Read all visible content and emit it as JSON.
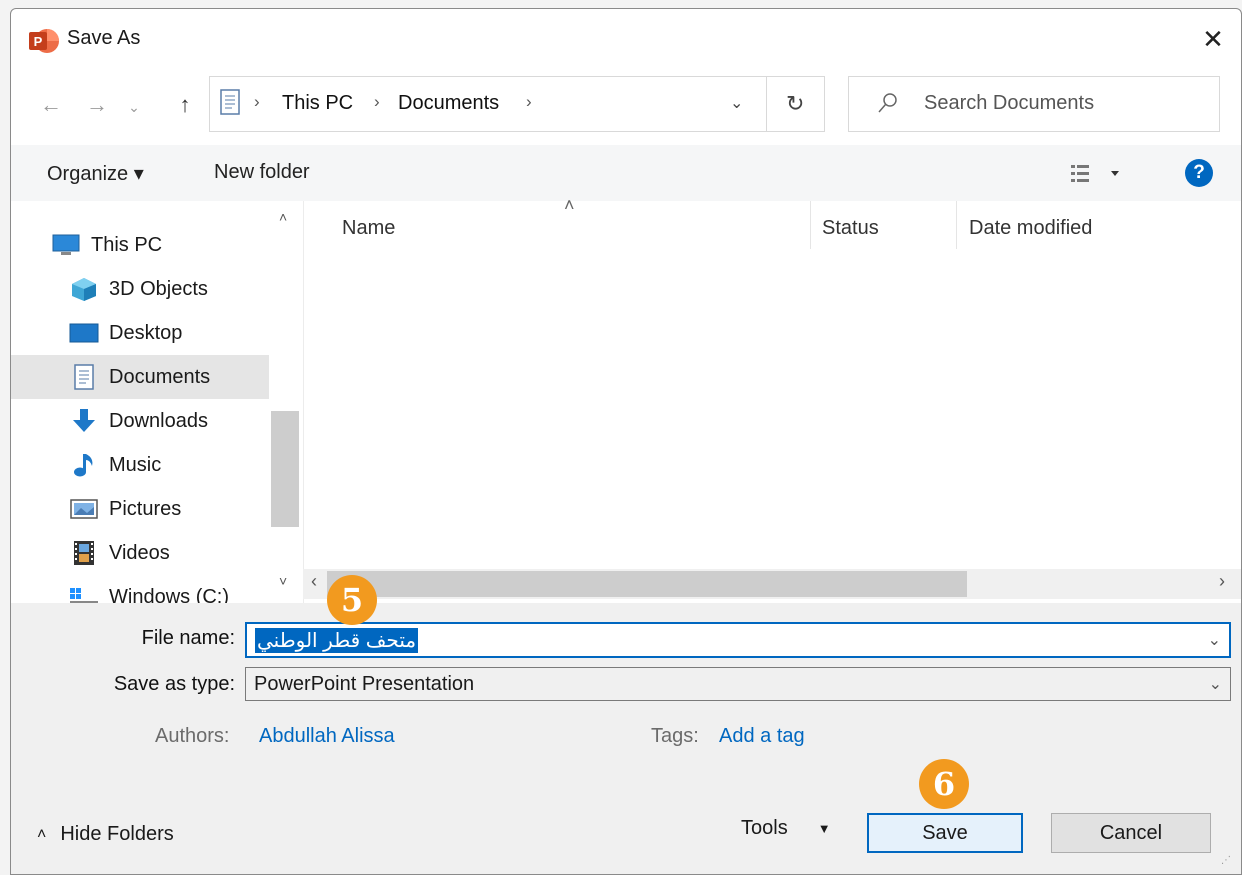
{
  "window": {
    "title": "Save As"
  },
  "address": {
    "segments": [
      "This PC",
      "Documents"
    ]
  },
  "search": {
    "placeholder": "Search Documents"
  },
  "toolbar": {
    "organize": "Organize ▾",
    "new_folder": "New folder"
  },
  "sidebar": {
    "items": [
      {
        "label": "This PC",
        "icon": "computer-icon"
      },
      {
        "label": "3D Objects",
        "icon": "cube-icon"
      },
      {
        "label": "Desktop",
        "icon": "desktop-icon"
      },
      {
        "label": "Documents",
        "icon": "document-icon",
        "selected": true
      },
      {
        "label": "Downloads",
        "icon": "download-arrow-icon"
      },
      {
        "label": "Music",
        "icon": "music-note-icon"
      },
      {
        "label": "Pictures",
        "icon": "picture-icon"
      },
      {
        "label": "Videos",
        "icon": "film-icon"
      },
      {
        "label": "Windows (C:)",
        "icon": "drive-icon"
      }
    ]
  },
  "columns": [
    "Name",
    "Status",
    "Date modified"
  ],
  "form": {
    "file_name_label": "File name:",
    "file_name_value": "متحف قطر الوطني",
    "save_type_label": "Save as type:",
    "save_type_value": "PowerPoint Presentation",
    "authors_label": "Authors:",
    "authors_value": "Abdullah Alissa",
    "tags_label": "Tags:",
    "tags_value": "Add a tag"
  },
  "footer": {
    "hide_folders": "Hide Folders",
    "tools": "Tools",
    "save": "Save",
    "cancel": "Cancel"
  },
  "callouts": [
    "5",
    "6"
  ],
  "colors": {
    "accent": "#0067c0",
    "callout": "#f29a1f",
    "powerpoint": "#c43e1c"
  }
}
